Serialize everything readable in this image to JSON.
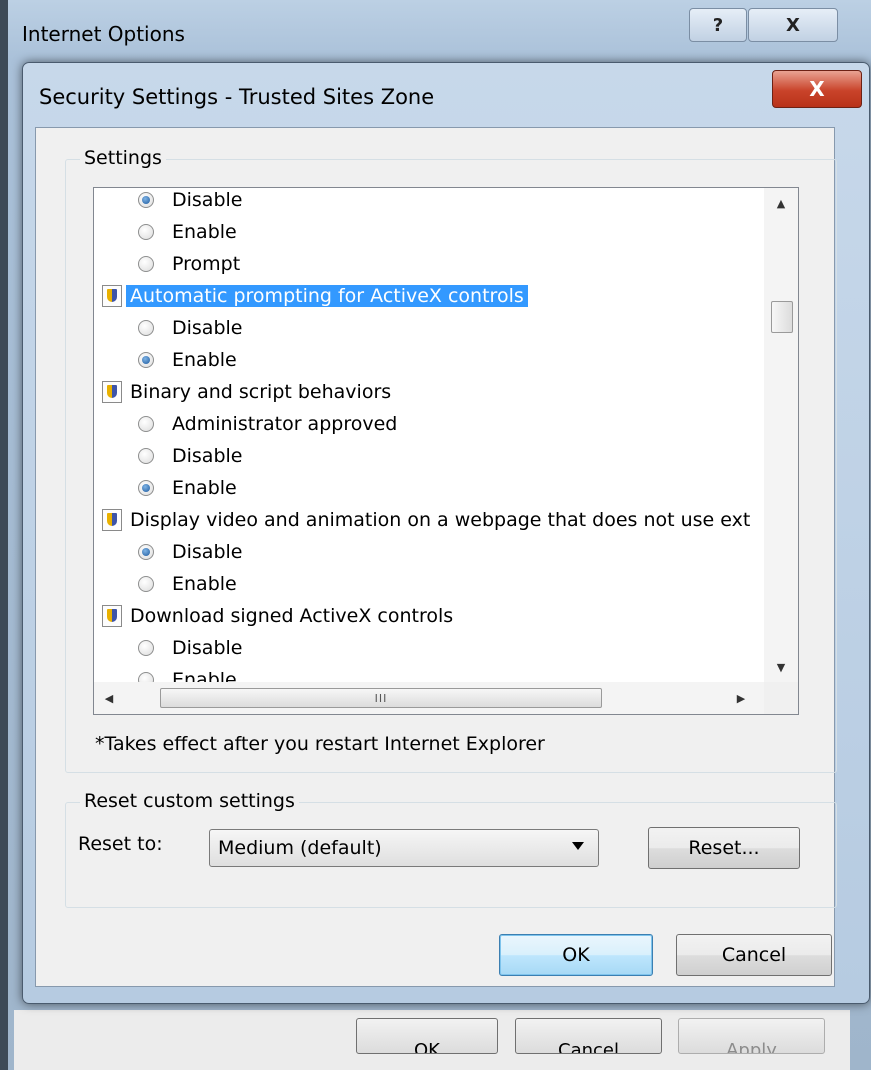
{
  "parent_window": {
    "title": "Internet Options",
    "help_label": "?",
    "close_label": "X",
    "buttons": [
      "OK",
      "Cancel",
      "Apply"
    ]
  },
  "dialog": {
    "title": "Security Settings - Trusted Sites Zone",
    "close_label": "X"
  },
  "settings": {
    "group_label": "Settings",
    "items": [
      {
        "kind": "option",
        "label": "Disable",
        "checked": true
      },
      {
        "kind": "option",
        "label": "Enable",
        "checked": false
      },
      {
        "kind": "option",
        "label": "Prompt",
        "checked": false
      },
      {
        "kind": "header",
        "label": "Automatic prompting for ActiveX controls",
        "selected": true
      },
      {
        "kind": "option",
        "label": "Disable",
        "checked": false
      },
      {
        "kind": "option",
        "label": "Enable",
        "checked": true
      },
      {
        "kind": "header",
        "label": "Binary and script behaviors",
        "selected": false
      },
      {
        "kind": "option",
        "label": "Administrator approved",
        "checked": false
      },
      {
        "kind": "option",
        "label": "Disable",
        "checked": false
      },
      {
        "kind": "option",
        "label": "Enable",
        "checked": true
      },
      {
        "kind": "header",
        "label": "Display video and animation on a webpage that does not use ext",
        "selected": false
      },
      {
        "kind": "option",
        "label": "Disable",
        "checked": true
      },
      {
        "kind": "option",
        "label": "Enable",
        "checked": false
      },
      {
        "kind": "header",
        "label": "Download signed ActiveX controls",
        "selected": false
      },
      {
        "kind": "option",
        "label": "Disable",
        "checked": false
      },
      {
        "kind": "option",
        "label": "Enable",
        "checked": false
      }
    ],
    "hscroll_grip": "III",
    "note": "*Takes effect after you restart Internet Explorer"
  },
  "reset": {
    "group_label": "Reset custom settings",
    "reset_to_label": "Reset to:",
    "selected_level": "Medium (default)",
    "reset_button": "Reset..."
  },
  "footer": {
    "ok_label": "OK",
    "cancel_label": "Cancel"
  },
  "icons": {
    "setting_header": "shield-icon",
    "scroll_up": "arrow-up-icon",
    "scroll_down": "arrow-down-icon",
    "scroll_left": "arrow-left-icon",
    "scroll_right": "arrow-right-icon",
    "dropdown": "chevron-down-icon"
  },
  "colors": {
    "selection": "#3399ff",
    "close_button": "#c9432a",
    "default_button_border": "#3c7fb1"
  }
}
